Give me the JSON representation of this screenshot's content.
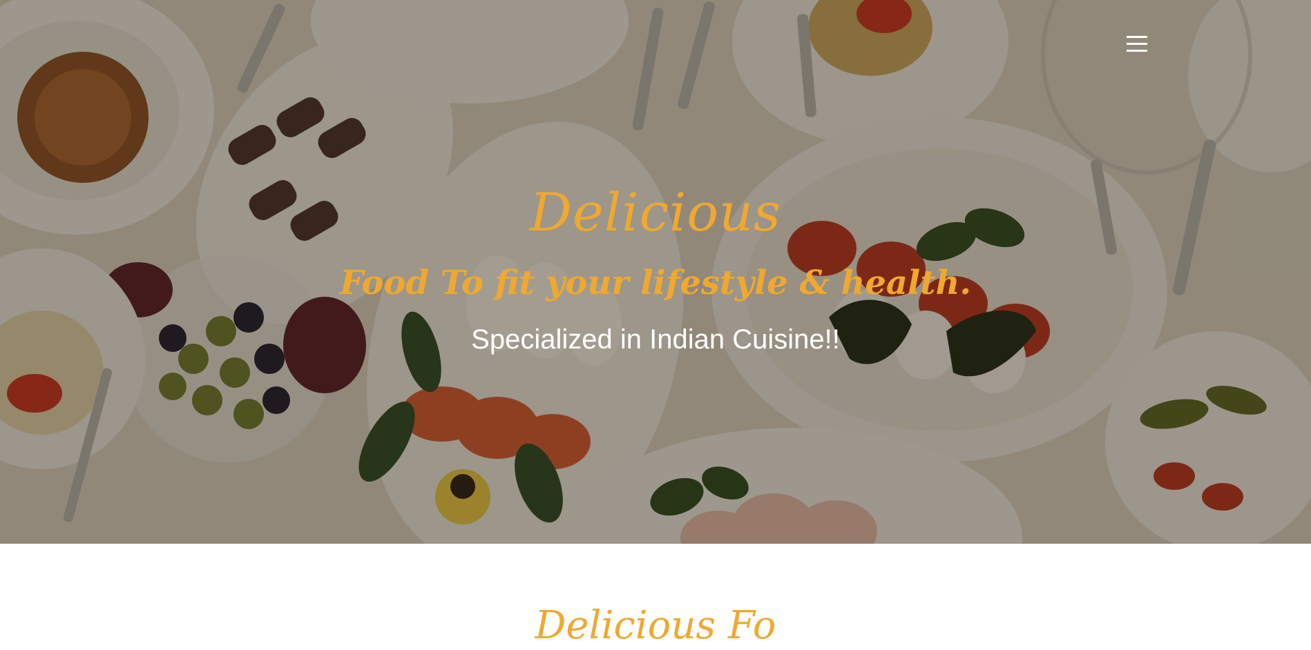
{
  "hero": {
    "title": "Delicious",
    "subtitle": "Food To fit your lifestyle & health.",
    "tagline": "Specialized in Indian Cuisine!!",
    "menu_icon": "hamburger-menu-icon"
  },
  "section": {
    "heading": "Delicious Fo"
  },
  "colors": {
    "accent": "#f0a830",
    "hero_text": "#ffffff",
    "page_background": "#ffffff"
  }
}
